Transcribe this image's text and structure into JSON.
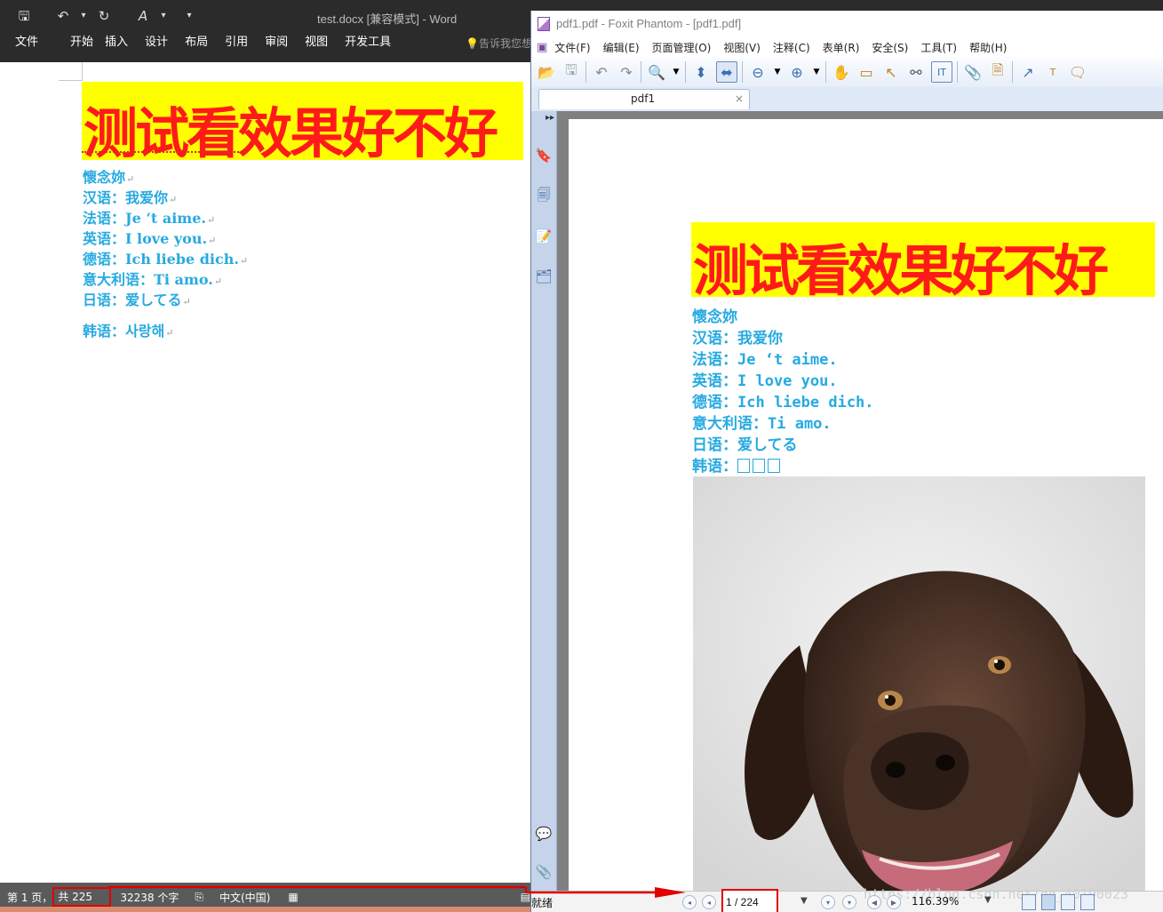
{
  "word": {
    "title": "test.docx [兼容模式] - Word",
    "qat": {
      "save": "🖫",
      "undo": "↶",
      "undo_dd": "▾",
      "redo": "↻",
      "format": "A",
      "format_dd": "▾",
      "more": "▾"
    },
    "tabs": [
      "文件",
      "开始",
      "插入",
      "设计",
      "布局",
      "引用",
      "审阅",
      "视图",
      "开发工具"
    ],
    "tell_me": "告诉我您想",
    "document": {
      "title": "测试看效果好不好",
      "lines": [
        "懷念妳",
        "汉语：我爱你",
        "法语：Je ‘t aime.",
        "英语：I love you.",
        "德语：Ich liebe dich.",
        "意大利语：Ti amo.",
        "日语：爱してる",
        "韩语：사랑해"
      ],
      "pilcrow": "↵"
    },
    "status": {
      "page": "第 1 页，",
      "total_pages": "共 225 页",
      "word_count": "32238 个字",
      "language": "中文(中国)"
    }
  },
  "foxit": {
    "title": "pdf1.pdf - Foxit Phantom - [pdf1.pdf]",
    "menu": [
      "文件(F)",
      "编辑(E)",
      "页面管理(O)",
      "视图(V)",
      "注释(C)",
      "表单(R)",
      "安全(S)",
      "工具(T)",
      "帮助(H)"
    ],
    "tab_label": "pdf1",
    "tab_close": "×",
    "document": {
      "title": "测试看效果好不好",
      "lines": [
        "懷念妳",
        "汉语：我爱你",
        "法语：Je ‘t aime.",
        "英语：I love you.",
        "德语：Ich liebe dich.",
        "意大利语：Ti amo.",
        "日语：爱してる"
      ],
      "korean_label": "韩语："
    },
    "status": {
      "ready": "就绪",
      "page_field": "1 / 224",
      "zoom": "116.39%",
      "watermark": "https://blog.csdn.net/qq_40190023"
    }
  },
  "colors": {
    "word_ribbon": "#2b2b2b",
    "title_highlight": "#ffff00",
    "title_text": "#ff1a1a",
    "body_text": "#27aae1",
    "annotation": "#e00000"
  }
}
